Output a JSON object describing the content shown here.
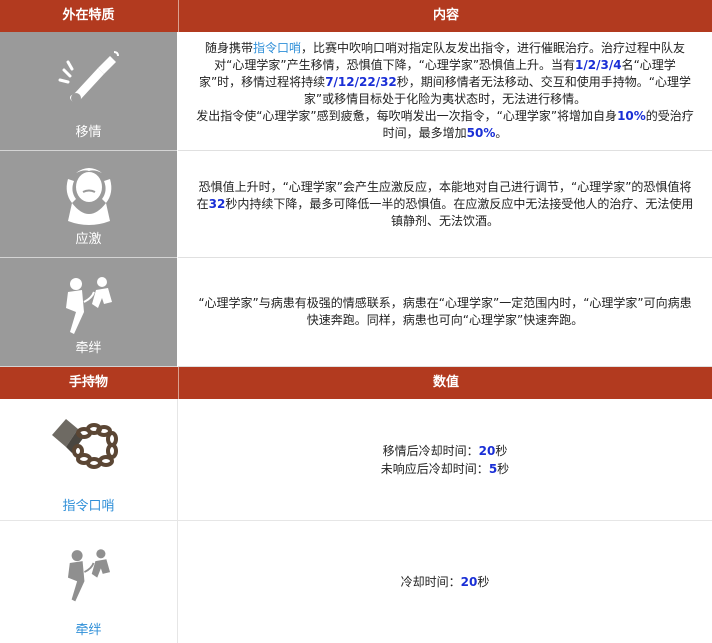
{
  "traits_header": {
    "col1": "外在特质",
    "col2": "内容"
  },
  "traits": [
    {
      "name": "移情",
      "icon": "whistle-icon",
      "paragraphs": [
        [
          {
            "t": "随身携带"
          },
          {
            "t": "指令口哨",
            "style": "link"
          },
          {
            "t": "，比赛中吹响口哨对指定队友发出指令，进行催眠治疗。治疗过程中队友对“心理学家”产生移情，恐惧值下降，“心理学家”恐惧值上升。当有"
          },
          {
            "t": "1/2/3/4",
            "style": "num"
          },
          {
            "t": "名“心理学家”时，移情过程将持续"
          },
          {
            "t": "7/12/22/32",
            "style": "num"
          },
          {
            "t": "秒，期间移情者无法移动、交互和使用手持物。“心理学家”或移情目标处于化险为夷状态时，无法进行移情。"
          }
        ],
        [
          {
            "t": "发出指令使“心理学家”感到疲惫，每吹哨发出一次指令，“心理学家”将增加自身"
          },
          {
            "t": "10%",
            "style": "num"
          },
          {
            "t": "的受治疗时间，最多增加"
          },
          {
            "t": "50%",
            "style": "num"
          },
          {
            "t": "。"
          }
        ]
      ]
    },
    {
      "name": "应激",
      "icon": "anxious-head-icon",
      "paragraphs": [
        [
          {
            "t": "恐惧值上升时，“心理学家”会产生应激反应，本能地对自己进行调节，“心理学家”的恐惧值将在"
          },
          {
            "t": "32",
            "style": "num"
          },
          {
            "t": "秒内持续下降，最多可降低一半的恐惧值。在应激反应中无法接受他人的治疗、无法使用镇静剂、无法饮酒。"
          }
        ]
      ]
    },
    {
      "name": "牵绊",
      "icon": "bond-figures-icon",
      "paragraphs": [
        [
          {
            "t": "“心理学家”与病患有极强的情感联系，病患在“心理学家”一定范围内时，“心理学家”可向病患快速奔跑。同样，病患也可向“心理学家”快速奔跑。"
          }
        ]
      ]
    }
  ],
  "items_header": {
    "col1": "手持物",
    "col2": "数值"
  },
  "items": [
    {
      "name": "指令口哨",
      "icon": "whistle-chain-icon",
      "values": [
        [
          {
            "t": "移情后冷却时间："
          },
          {
            "t": "20",
            "style": "num"
          },
          {
            "t": "秒"
          }
        ],
        [
          {
            "t": "未响应后冷却时间："
          },
          {
            "t": "5",
            "style": "num"
          },
          {
            "t": "秒"
          }
        ]
      ]
    },
    {
      "name": "牵绊",
      "icon": "bond-figures-icon",
      "values": [
        [
          {
            "t": "冷却时间："
          },
          {
            "t": "20",
            "style": "num"
          },
          {
            "t": "秒"
          }
        ]
      ]
    }
  ],
  "colors": {
    "header_bg": "#b23a1f",
    "trait_bg": "#9a9a9a",
    "number": "#1a2fd6",
    "link": "#2f8fd8"
  }
}
